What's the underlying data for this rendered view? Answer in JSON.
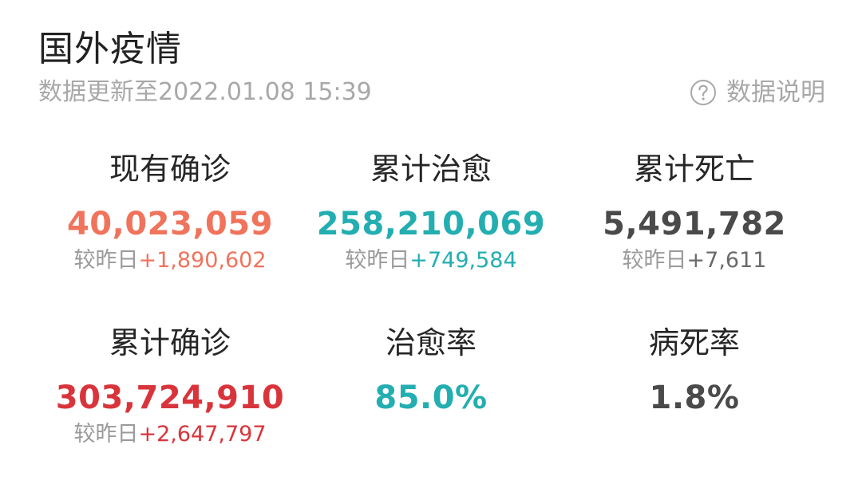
{
  "header": {
    "title": "国外疫情",
    "update_time": "数据更新至2022.01.08 15:39",
    "data_explain_label": "数据说明",
    "help_icon": "question-circle-icon"
  },
  "delta_prefix": "较昨日",
  "colors": {
    "orange": "#f0735c",
    "teal": "#23aeb1",
    "dark": "#4a4a4a",
    "red": "#d9343b",
    "muted": "#a8a8a8"
  },
  "stats": {
    "current_confirmed": {
      "label": "现有确诊",
      "value": "40,023,059",
      "delta": "+1,890,602"
    },
    "total_recovered": {
      "label": "累计治愈",
      "value": "258,210,069",
      "delta": "+749,584"
    },
    "total_deaths": {
      "label": "累计死亡",
      "value": "5,491,782",
      "delta": "+7,611"
    },
    "total_confirmed": {
      "label": "累计确诊",
      "value": "303,724,910",
      "delta": "+2,647,797"
    },
    "recovery_rate": {
      "label": "治愈率",
      "value": "85.0%"
    },
    "fatality_rate": {
      "label": "病死率",
      "value": "1.8%"
    }
  }
}
